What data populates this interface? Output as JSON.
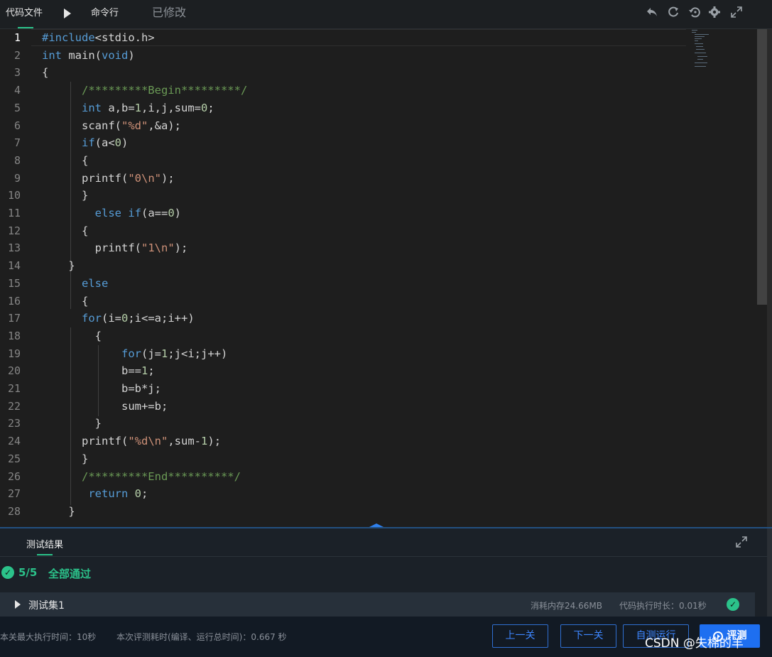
{
  "toolbar": {
    "code_file_tab": "代码文件",
    "command_line_tab": "命令行",
    "status": "已修改",
    "icons": [
      "undo-icon",
      "refresh-icon",
      "history-icon",
      "gear-icon",
      "expand-icon"
    ]
  },
  "editor": {
    "active_line": 1,
    "line_numbers": [
      "1",
      "2",
      "3",
      "4",
      "5",
      "6",
      "7",
      "8",
      "9",
      "10",
      "11",
      "12",
      "13",
      "14",
      "15",
      "16",
      "17",
      "18",
      "19",
      "20",
      "21",
      "22",
      "23",
      "24",
      "25",
      "26",
      "27",
      "28"
    ],
    "lines": [
      "#include<stdio.h>",
      "int main(void)",
      "{",
      "      /*********Begin*********/",
      "      int a,b=1,i,j,sum=0;",
      "      scanf(\"%d\",&a);",
      "      if(a<0)",
      "      {",
      "      printf(\"0\\n\");",
      "      }",
      "        else if(a==0)",
      "      {",
      "        printf(\"1\\n\");",
      "    }",
      "      else",
      "      {",
      "      for(i=0;i<=a;i++)",
      "        {",
      "            for(j=1;j<i;j++)",
      "            b==1;",
      "            b=b*j;",
      "            sum+=b;",
      "        }",
      "      printf(\"%d\\n\",sum-1);",
      "      }",
      "      /*********End**********/",
      "       return 0;",
      "    }"
    ]
  },
  "results": {
    "tab_label": "测试结果",
    "pass_count": "5/5",
    "pass_label": "全部通过",
    "test_set": {
      "name": "测试集1",
      "memory": "消耗内存24.66MB",
      "exec_time": "代码执行时长：0.01秒",
      "status": "passed"
    }
  },
  "bottom": {
    "max_time": "本关最大执行时间：10秒",
    "eval_time": "本次评测耗时(编译、运行总时间)：0.667 秒",
    "prev_label": "上一关",
    "next_label": "下一关",
    "self_run_label": "自测运行",
    "evaluate_label": "评测",
    "watermark": "CSDN @失棉的羊"
  },
  "colors": {
    "accent_green": "#2bc28a",
    "accent_blue": "#1e6ff0",
    "keyword": "#569cd6",
    "string": "#ce9178",
    "number": "#b5cea8",
    "comment": "#6a9955"
  }
}
